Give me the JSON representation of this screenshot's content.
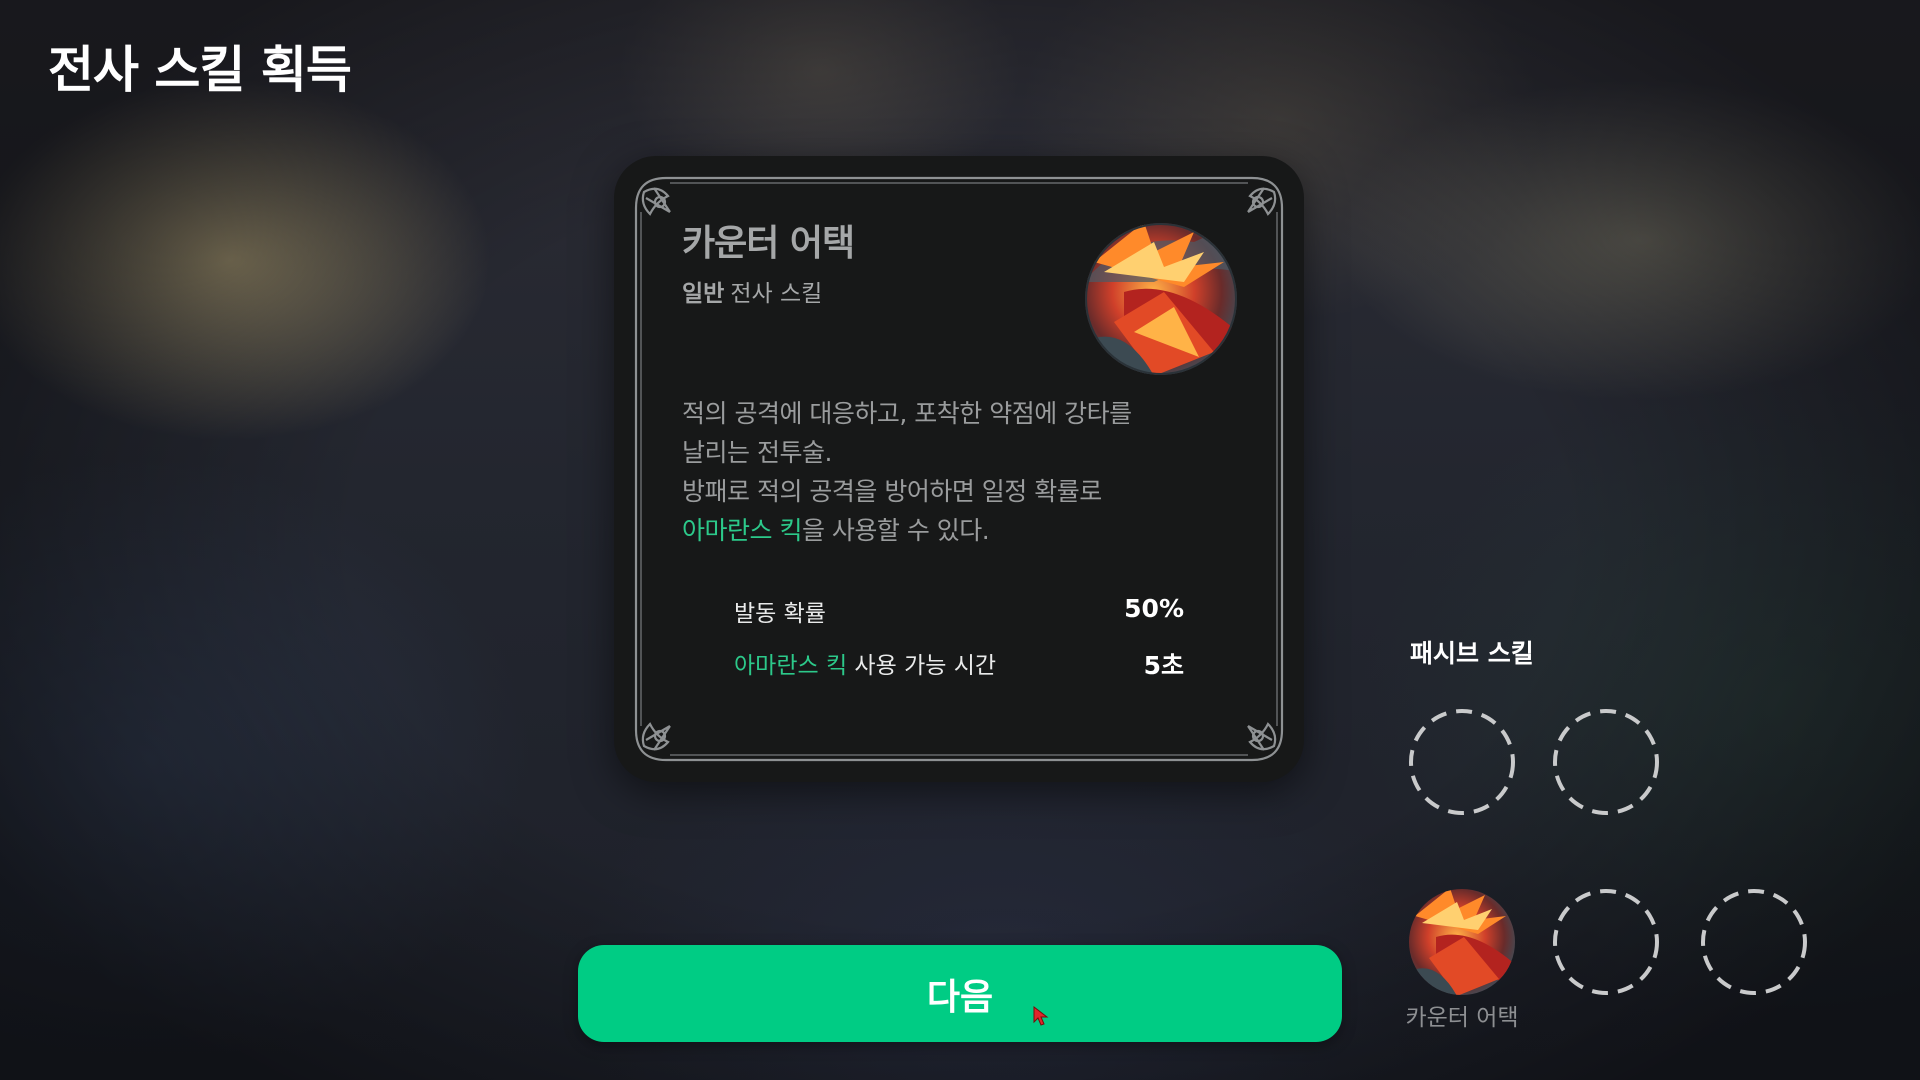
{
  "page": {
    "title": "전사 스킬 획득"
  },
  "card": {
    "skill_name": "카운터 어택",
    "rarity": "일반",
    "category": "전사 스킬",
    "description": {
      "line1": "적의 공격에 대응하고, 포착한 약점에 강타를",
      "line2": "날리는 전투술.",
      "line3": "방패로 적의 공격을 방어하면 일정 확률로",
      "line4_highlight": "아마란스 킥",
      "line4_rest": "을 사용할 수 있다."
    },
    "stats": [
      {
        "label": "발동 확률",
        "value": "50%"
      },
      {
        "label_highlight": "아마란스 킥",
        "label_rest": " 사용 가능 시간",
        "value": "5초"
      }
    ],
    "icon": "flame-slash-skill-icon"
  },
  "passive": {
    "title": "패시브 스킬",
    "slots": [
      {
        "state": "empty"
      },
      {
        "state": "empty"
      },
      {
        "state": "filled",
        "label": "카운터 어택",
        "icon": "flame-slash-skill-icon"
      },
      {
        "state": "empty"
      },
      {
        "state": "empty"
      }
    ]
  },
  "next_button": {
    "label": "다음"
  },
  "colors": {
    "accent_green": "#00cc84",
    "highlight_text": "#2cc98a",
    "card_bg": "#171818"
  }
}
